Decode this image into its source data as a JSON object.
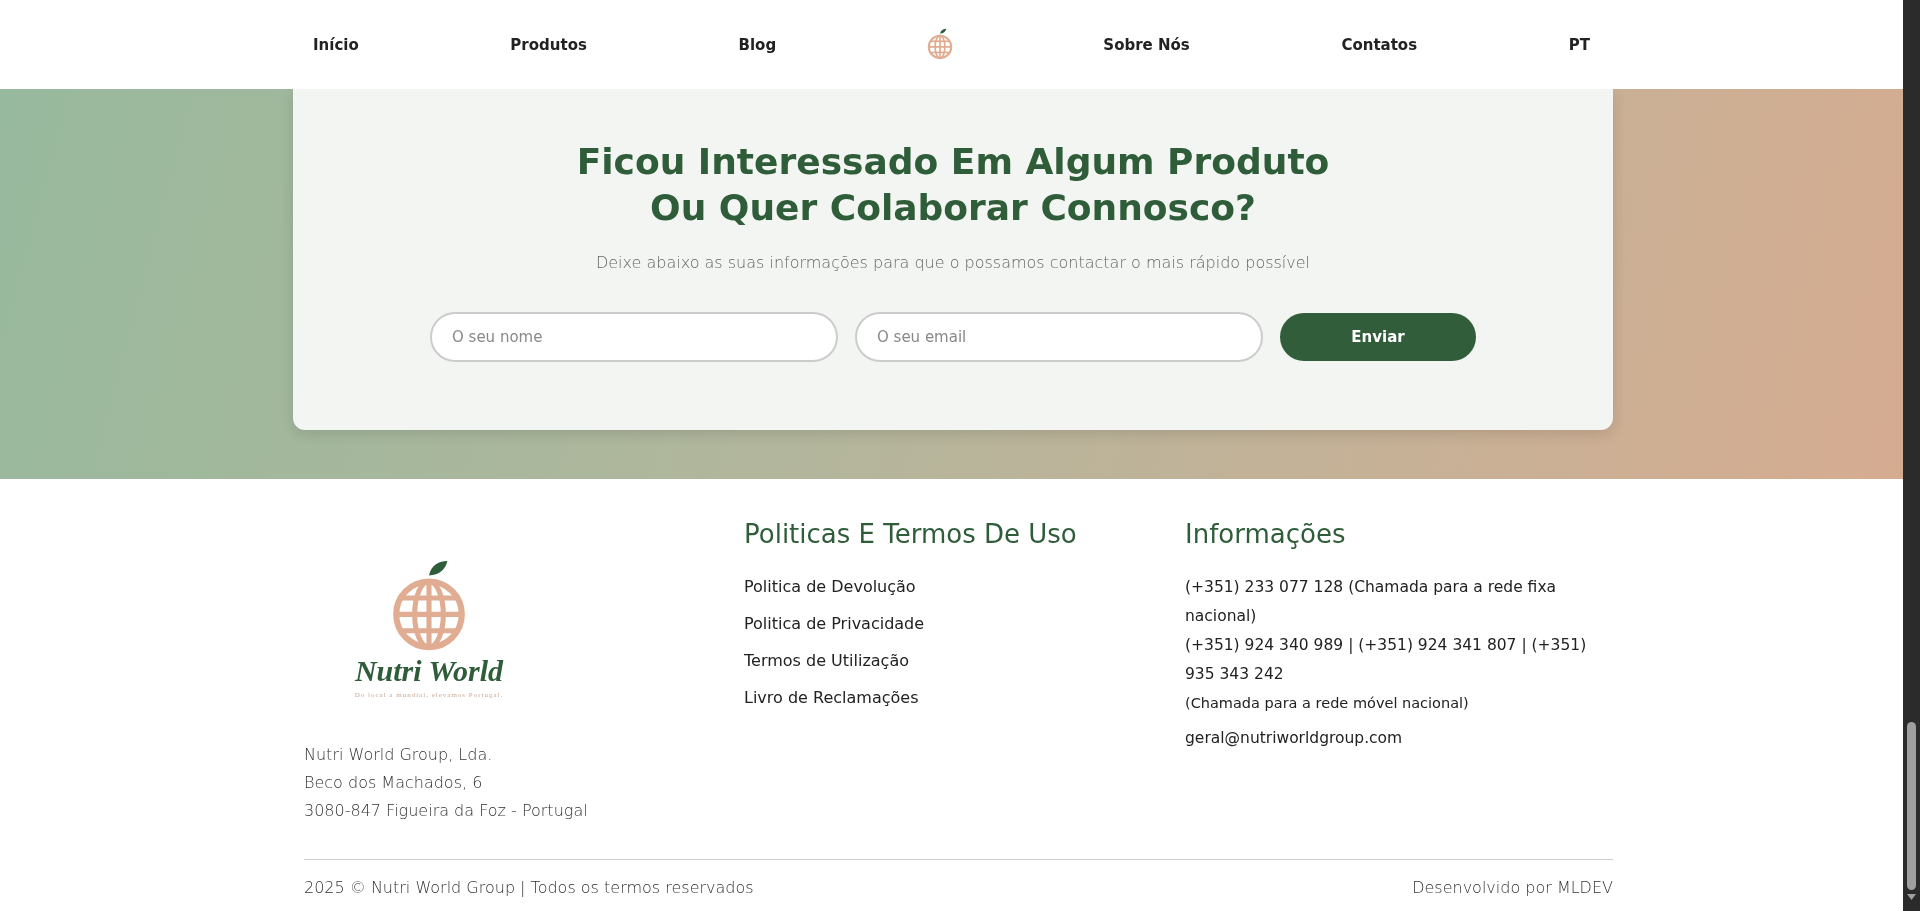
{
  "nav": {
    "items": [
      {
        "kind": "link",
        "label": "Início"
      },
      {
        "kind": "link",
        "label": "Produtos"
      },
      {
        "kind": "link",
        "label": "Blog"
      },
      {
        "kind": "logo"
      },
      {
        "kind": "link",
        "label": "Sobre Nós"
      },
      {
        "kind": "link",
        "label": "Contatos"
      },
      {
        "kind": "language",
        "label": "PT"
      }
    ]
  },
  "contact_card": {
    "title_lines": [
      "Ficou Interessado Em Algum Produto",
      "Ou Quer Colaborar Connosco?"
    ],
    "subtitle": "Deixe abaixo as suas informações para que o possamos contactar o mais rápido possível",
    "name_field": {
      "placeholder": "O seu nome"
    },
    "email_field": {
      "placeholder": "O seu email"
    },
    "submit_button": "Enviar"
  },
  "footer": {
    "logo": {
      "name": "Nutri World",
      "tagline": "Do local a mundial, elevamos Portugal."
    },
    "address": [
      "Nutri World Group, Lda.",
      "Beco dos Machados, 6",
      "3080-847 Figueira da Foz - Portugal"
    ],
    "policies": {
      "heading": "Politicas E Termos De Uso",
      "links": [
        "Politica de Devolução",
        "Politica de Privacidade",
        "Termos de Utilização",
        "Livro de Reclamações"
      ]
    },
    "info": {
      "heading": "Informações",
      "items": [
        {
          "kind": "text",
          "text": "(+351) 233 077 128 (Chamada para a rede fixa nacional)"
        },
        {
          "kind": "text",
          "text": "(+351) 924 340 989 | (+351) 924 341 807 | (+351) 935 343 242"
        },
        {
          "kind": "note",
          "text": "(Chamada para a rede móvel nacional)"
        },
        {
          "kind": "email",
          "text": "geral@nutriworldgroup.com"
        }
      ]
    },
    "copyright": "2025 © Nutri World Group | Todos os termos reservados",
    "credit": "Desenvolvido por MLDEV"
  }
}
